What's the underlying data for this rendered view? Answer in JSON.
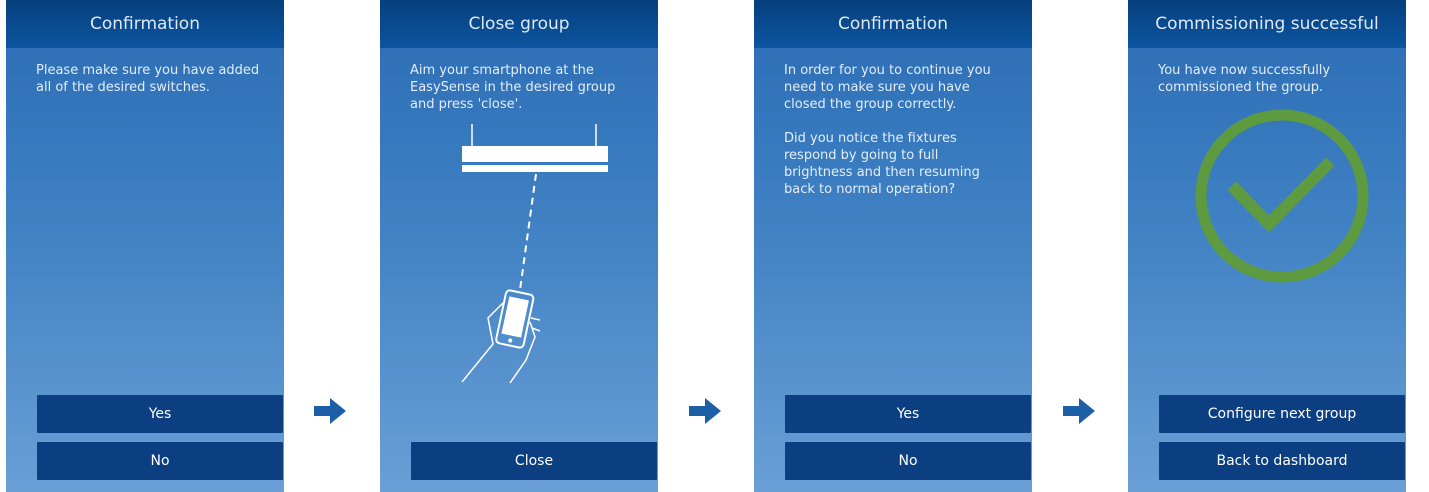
{
  "colors": {
    "header": "#0c55a0",
    "button": "#0b3f82",
    "screen_top": "#2a6bb4",
    "screen_bottom": "#6a9fd6",
    "arrow": "#1d5fa6",
    "success_ring": "#5e9a3f"
  },
  "screens": [
    {
      "title": "Confirmation",
      "paragraphs": [
        "Please make sure you have added all of the desired switches."
      ],
      "buttons": [
        "Yes",
        "No"
      ]
    },
    {
      "title": "Close group",
      "paragraphs": [
        "Aim your smartphone at the EasySense in the desired group and press 'close'."
      ],
      "buttons": [
        "Close"
      ],
      "illustration": "smartphone-aimed-at-easysense-icon"
    },
    {
      "title": "Confirmation",
      "paragraphs": [
        "In order for you to continue you need to make sure you have closed the group correctly.",
        "Did you notice the fixtures respond by going to full brightness and then resuming back to normal operation?"
      ],
      "buttons": [
        "Yes",
        "No"
      ]
    },
    {
      "title": "Commissioning successful",
      "paragraphs": [
        "You have now successfully commissioned the group."
      ],
      "buttons": [
        "Configure next group",
        "Back to dashboard"
      ],
      "illustration": "success-checkmark-icon"
    }
  ],
  "flow_arrow_icon": "arrow-right-icon"
}
